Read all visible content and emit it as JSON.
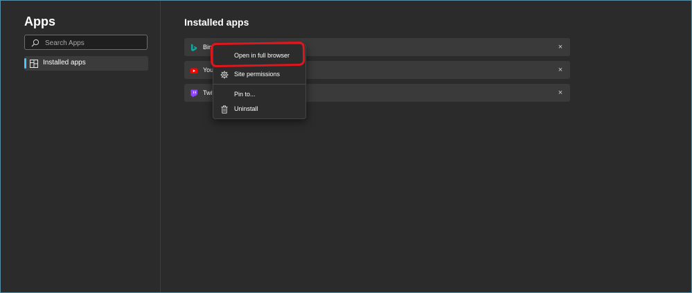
{
  "sidebar": {
    "title": "Apps",
    "search": {
      "placeholder": "Search Apps",
      "icon": "search-icon"
    },
    "nav_items": [
      {
        "label": "Installed apps",
        "icon": "apps-grid-icon",
        "selected": true
      }
    ]
  },
  "main": {
    "title": "Installed apps",
    "apps": [
      {
        "name": "Bing",
        "icon": "bing-icon",
        "icon_color": "#13a89e",
        "close": "×"
      },
      {
        "name": "You",
        "icon": "youtube-icon",
        "icon_color": "#ff0000",
        "close": "×"
      },
      {
        "name": "Twit",
        "icon": "twitch-icon",
        "icon_color": "#9146ff",
        "close": "×"
      }
    ]
  },
  "context_menu": {
    "items": [
      {
        "label": "Open in full browser",
        "icon": ""
      },
      {
        "label": "Site permissions",
        "icon": "gear-icon"
      },
      {
        "label": "Pin to...",
        "icon": ""
      },
      {
        "label": "Uninstall",
        "icon": "trash-icon"
      }
    ]
  },
  "colors": {
    "accent": "#4cc2ff",
    "highlight_annotation": "#e0161d",
    "background": "#2b2b2b"
  }
}
